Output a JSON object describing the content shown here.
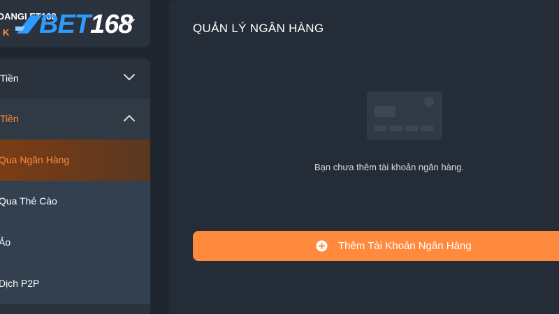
{
  "user": {
    "name": "OANGI     ET168",
    "balance": "K"
  },
  "logo": {
    "prefix": "BET",
    "suffix": "168"
  },
  "menu": {
    "items": [
      {
        "label": "Tiền"
      },
      {
        "label": "Tiền"
      }
    ],
    "sub_items": [
      {
        "label": "Qua Ngân Hàng"
      },
      {
        "label": "Qua Thẻ Cào"
      },
      {
        "label": "Ảo"
      },
      {
        "label": "Dịch P2P"
      }
    ]
  },
  "main": {
    "title": "QUẢN LÝ NGÂN HÀNG",
    "empty_message": "Bạn chưa thêm tài khoản ngân hàng.",
    "add_button_label": "Thêm Tài Khoản Ngân Hàng"
  },
  "colors": {
    "accent": "#ff8a3d",
    "background": "#1f262e",
    "panel": "#242d37",
    "sidebar": "#2a333d"
  },
  "icons": {
    "expand": "chevron-down-icon",
    "collapse": "chevron-up-icon",
    "add": "plus-circle-icon",
    "empty_state": "bank-card-icon"
  }
}
